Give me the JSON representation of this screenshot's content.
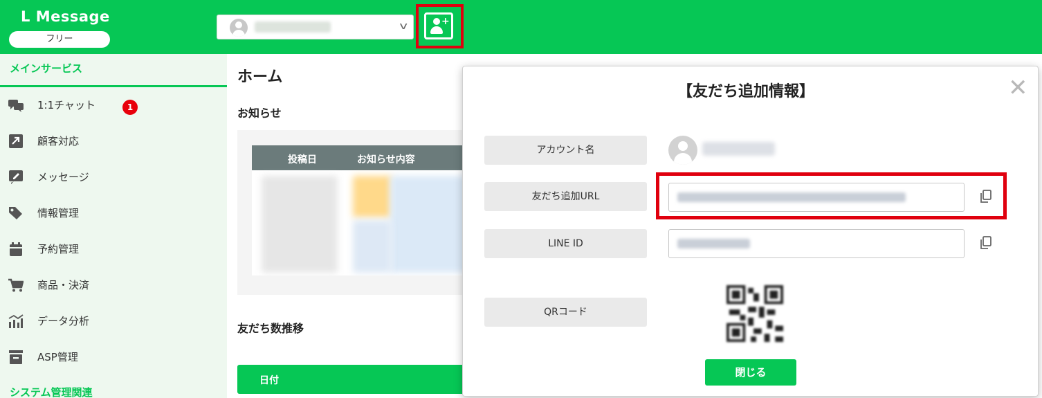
{
  "header": {
    "logo": "L Message",
    "plan": "フリー",
    "account_selector_name": "",
    "add_friend_icon": "add-user-icon"
  },
  "sidebar": {
    "main_section": "メインサービス",
    "items": [
      {
        "label": "1:1チャット",
        "icon": "chat-icon",
        "badge": "1"
      },
      {
        "label": "顧客対応",
        "icon": "arrow-icon"
      },
      {
        "label": "メッセージ",
        "icon": "edit-icon"
      },
      {
        "label": "情報管理",
        "icon": "tag-icon"
      },
      {
        "label": "予約管理",
        "icon": "calendar-icon"
      },
      {
        "label": "商品・決済",
        "icon": "cart-icon"
      },
      {
        "label": "データ分析",
        "icon": "chart-icon"
      },
      {
        "label": "ASP管理",
        "icon": "archive-icon"
      }
    ],
    "system_section": "システム管理関連"
  },
  "main": {
    "title": "ホーム",
    "news_heading": "お知らせ",
    "news_columns": [
      "投稿日",
      "お知らせ内容"
    ],
    "friends_heading": "友だち数推移",
    "date_header": "日付"
  },
  "modal": {
    "title": "【友だち追加情報】",
    "close_symbol": "✕",
    "account_label": "アカウント名",
    "url_label": "友だち追加URL",
    "url_value": "",
    "line_id_label": "LINE ID",
    "line_id_value": "",
    "qr_label": "QRコード",
    "close_button": "閉じる"
  },
  "colors": {
    "brand_green": "#06c755",
    "highlight_red": "#e0000e",
    "sidebar_bg": "#eef8ef"
  }
}
